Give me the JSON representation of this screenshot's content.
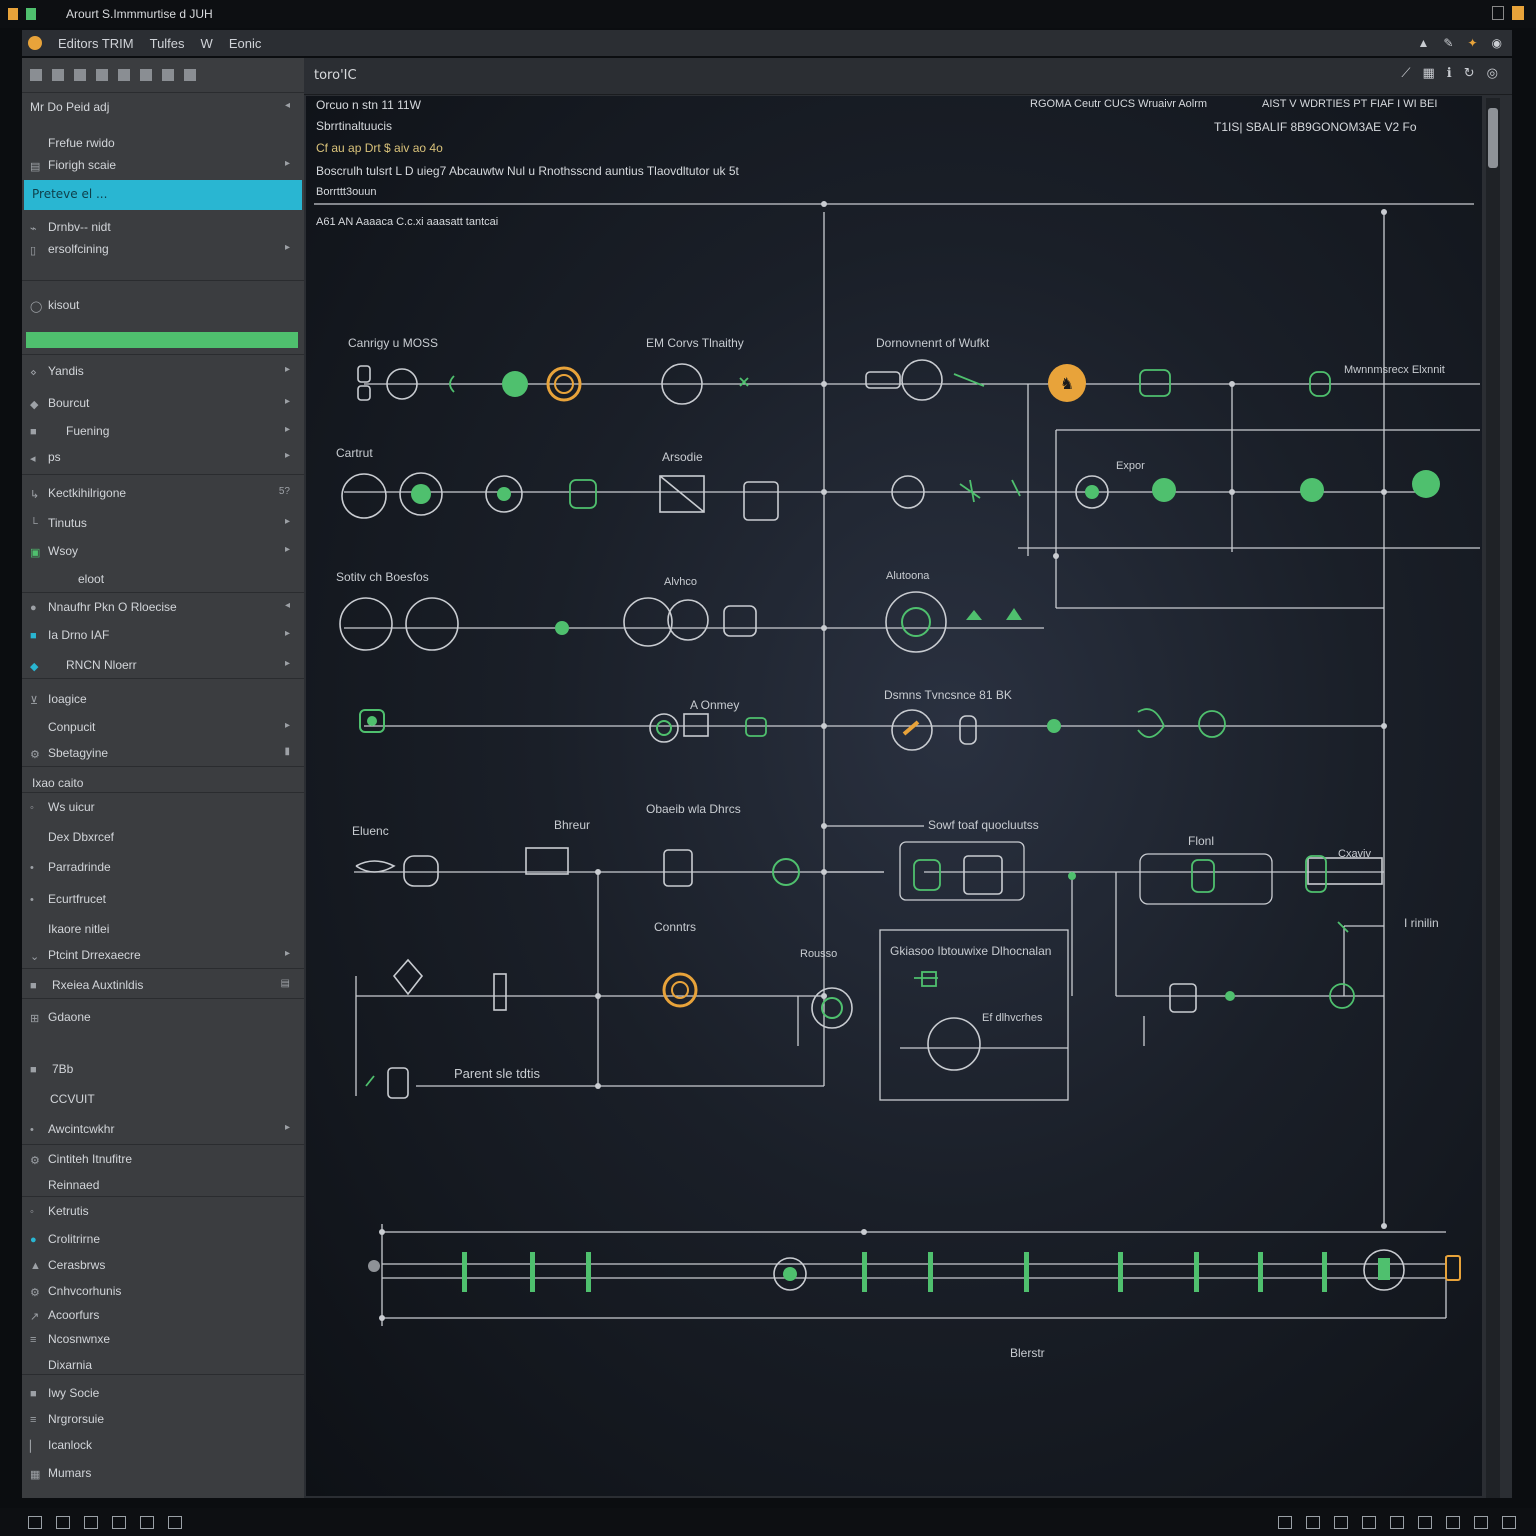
{
  "window": {
    "title": "Arourt S.Immmurtise d JUH"
  },
  "menu": {
    "items": [
      "Editors TRIM",
      "Tulfes",
      "W",
      "Eonic"
    ]
  },
  "sidebar": {
    "items": [
      {
        "label": "Mr Do Peid adj"
      },
      {
        "label": "Frefue rwido"
      },
      {
        "label": "Fiorigh scaie"
      },
      {
        "label": "Preteve el ..."
      },
      {
        "label": "Drnbv-- nidt"
      },
      {
        "label": "ersolfcining"
      },
      {
        "label": "kisout"
      },
      {
        "label": "Yandis"
      },
      {
        "label": "Bourcut"
      },
      {
        "label": "Fuening"
      },
      {
        "label": "ps"
      },
      {
        "label": "Kectkihilrigone"
      },
      {
        "label": "Tinutus"
      },
      {
        "label": "Wsoy"
      },
      {
        "label": "eloot"
      },
      {
        "label": "Nnaufhr Pkn  O Rloecise"
      },
      {
        "label": "Ia Drno  IAF"
      },
      {
        "label": "RNCN Nloerr"
      },
      {
        "label": "Ioagice"
      },
      {
        "label": "Conpucit"
      },
      {
        "label": "Sbetagyine"
      },
      {
        "label": "Ixao caito"
      },
      {
        "label": "Ws uicur"
      },
      {
        "label": "Dex Dbxrcef"
      },
      {
        "label": "Parradrinde"
      },
      {
        "label": "Ecurtfrucet"
      },
      {
        "label": "Ikaore nitlei"
      },
      {
        "label": "Ptcint Drrexaecre"
      },
      {
        "label": "Rxeiea Auxtinldis"
      },
      {
        "label": "Gdaone"
      },
      {
        "label": "7Bb"
      },
      {
        "label": "CCVUIT"
      },
      {
        "label": "Awcintcwkhr"
      },
      {
        "label": "Cintiteh Itnufitre"
      },
      {
        "label": "Reinnaed"
      },
      {
        "label": "Ketrutis"
      },
      {
        "label": "Crolitrirne"
      },
      {
        "label": "Cerasbrws"
      },
      {
        "label": "Cnhvcorhunis"
      },
      {
        "label": "Acoorfurs"
      },
      {
        "label": "Ncosnwnxe"
      },
      {
        "label": "Dixarnia"
      },
      {
        "label": "Iwy Socie"
      },
      {
        "label": "Nrgrorsuie"
      },
      {
        "label": "Icanlock"
      },
      {
        "label": "Mumars"
      }
    ]
  },
  "canvas": {
    "tab": "toro'IC",
    "header": {
      "line1": "Orcuo  n stn  11  11W",
      "line2": "Sbrrtinaltuucis",
      "line3": "Cf  au ap Drt  $ aiv ao 4o",
      "line4": "Boscrulh tulsrt L D  uieg7 Abcauwtw Nul  u Rnothsscnd auntius Tlaovdltutor  uk 5t",
      "line5": "Borrttt3ouun",
      "line6": "A61  AN Aaaaca C.c.xi aaasatt tantcai",
      "right1": "RGOMA  Ceutr   CUCS Wruaivr Aolrm",
      "right2": "AIST V   WDRTIES PT FIAF I WI BEI",
      "right3": "T1IS| SBALIF 8B9GONOM3AE V2 Fo"
    },
    "labels": {
      "r1a": "Canrigy u MOSS",
      "r1b": "EM Corvs Tlnaithy",
      "r1c": "Dornovnenrt of Wufkt",
      "r1d": "Mwnnmsrecx Elxnnit",
      "r2a": "Cartrut",
      "r2b": "Arsodie",
      "r2c": "Expor",
      "r3a": "Sotitv ch Boesfos",
      "r3b": "Alvhco",
      "r3c": "Alutoona",
      "r4a": "A Onmey",
      "r4b": "Dsmns Tvncsnce 81 BK",
      "r5a": "Eluenc",
      "r5b": "Bhreur",
      "r5c": "Obaeib  wla Dhrcs",
      "r5d": "Sowf toaf quocluutss",
      "r5e": "Flonl",
      "r5f": "Cxaviv",
      "r6a": "Conntrs",
      "r6b": "Gkiasoo Ibtouwixe  Dlhocnalan",
      "r6c": "Ef dlhvcrhes",
      "r6d": "Parent sle tdtis",
      "r6e": "I rinilin",
      "r6f": "Rousso",
      "bottom": "Blerstr"
    }
  },
  "colors": {
    "accent_cyan": "#29b6d2",
    "green": "#4fc06e",
    "orange": "#e8a33a",
    "wire": "#c9ccd1"
  }
}
